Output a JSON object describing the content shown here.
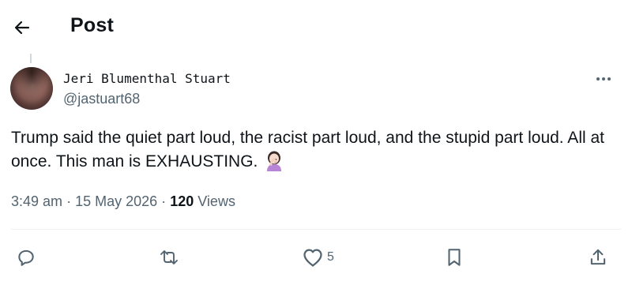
{
  "header": {
    "title": "Post",
    "back_icon": "arrow-left-icon"
  },
  "author": {
    "display_name": "Jeri Blumenthal Stuart",
    "handle": "@jastuart68"
  },
  "tweet": {
    "text": "Trump said the quiet part loud, the racist part loud, and the stupid part loud. All at once. This man is EXHAUSTING.",
    "emoji": "woman-facepalming-emoji"
  },
  "meta": {
    "time": "3:49 am",
    "separator": "·",
    "date": "15 May 2026",
    "views_count": "120",
    "views_label": "Views"
  },
  "actions": {
    "reply_icon": "reply-icon",
    "retweet_icon": "retweet-icon",
    "like_icon": "heart-icon",
    "like_count": "5",
    "bookmark_icon": "bookmark-icon",
    "share_icon": "share-icon"
  },
  "colors": {
    "text": "#0f1419",
    "secondary": "#536471",
    "divider": "#eff3f4"
  }
}
